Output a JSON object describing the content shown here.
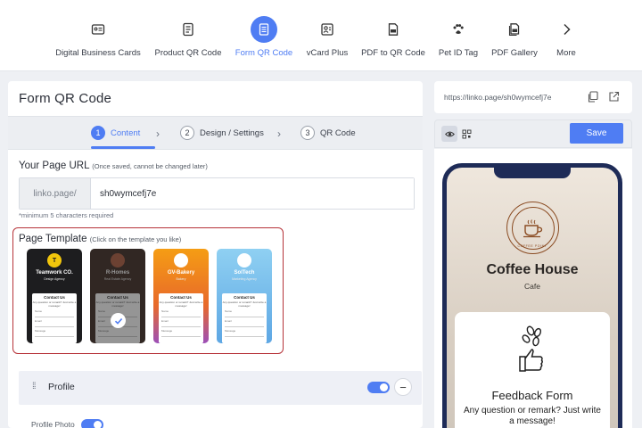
{
  "nav": {
    "items": [
      {
        "label": "Digital Business Cards",
        "icon": "id-card-icon"
      },
      {
        "label": "Product QR Code",
        "icon": "barcode-icon"
      },
      {
        "label": "Form QR Code",
        "icon": "document-icon",
        "active": true
      },
      {
        "label": "vCard Plus",
        "icon": "contact-card-icon"
      },
      {
        "label": "PDF to QR Code",
        "icon": "pdf-icon"
      },
      {
        "label": "Pet ID Tag",
        "icon": "paw-icon"
      },
      {
        "label": "PDF Gallery",
        "icon": "pdf-gallery-icon"
      },
      {
        "label": "More",
        "icon": "chevron-right-icon"
      }
    ]
  },
  "editor": {
    "title": "Form QR Code",
    "steps": [
      {
        "num": "1",
        "label": "Content",
        "active": true
      },
      {
        "num": "2",
        "label": "Design / Settings"
      },
      {
        "num": "3",
        "label": "QR Code"
      }
    ],
    "page_url": {
      "label": "Your Page URL",
      "note": "(Once saved, cannot be changed later)",
      "prefix": "linko.page/",
      "value": "sh0wymcefj7e",
      "hint": "*minimum 5 characters required"
    },
    "template": {
      "label": "Page Template",
      "note": "(Click on the template you like)",
      "items": [
        {
          "name": "Teamwork CO.",
          "sub": "Design Agency",
          "card_title": "Contact Us",
          "card_sub": "Any question or remark? Just write a message!",
          "bg": "#1d1d1f",
          "logo": "#f2c60c"
        },
        {
          "name": "R-Homes",
          "sub": "Real Estate Agency",
          "card_title": "Contact Us",
          "card_sub": "Any question or remark? Just write a message!",
          "bg": "#4a3730",
          "logo": "#b5664c",
          "selected": true
        },
        {
          "name": "GV-Bakery",
          "sub": "Bakery",
          "card_title": "Contact Us",
          "card_sub": "Any question or remark? Just write a message!",
          "bg": "#f39a1c",
          "logo": "#ffffff"
        },
        {
          "name": "SolTech",
          "sub": "Marketing Agency",
          "card_title": "Contact Us",
          "card_sub": "Any question or remark? Just write a message!",
          "bg": "#6fb6e8",
          "logo": "#ffffff"
        }
      ],
      "field_labels": [
        "Name",
        "Email",
        "Message"
      ]
    },
    "profile": {
      "label": "Profile",
      "photo_label": "Profile Photo"
    }
  },
  "preview": {
    "url": "https://linko.page/sh0wymcefj7e",
    "save_label": "Save",
    "cafe_name": "Coffee House",
    "cafe_sub": "Cafe",
    "logo_text": "COFFEE POINT",
    "form_title": "Feedback Form",
    "form_sub": "Any question or remark? Just write a message!"
  },
  "colors": {
    "accent": "#4f7df3",
    "highlight_border": "#b63339",
    "phone_frame": "#1e2b57"
  }
}
